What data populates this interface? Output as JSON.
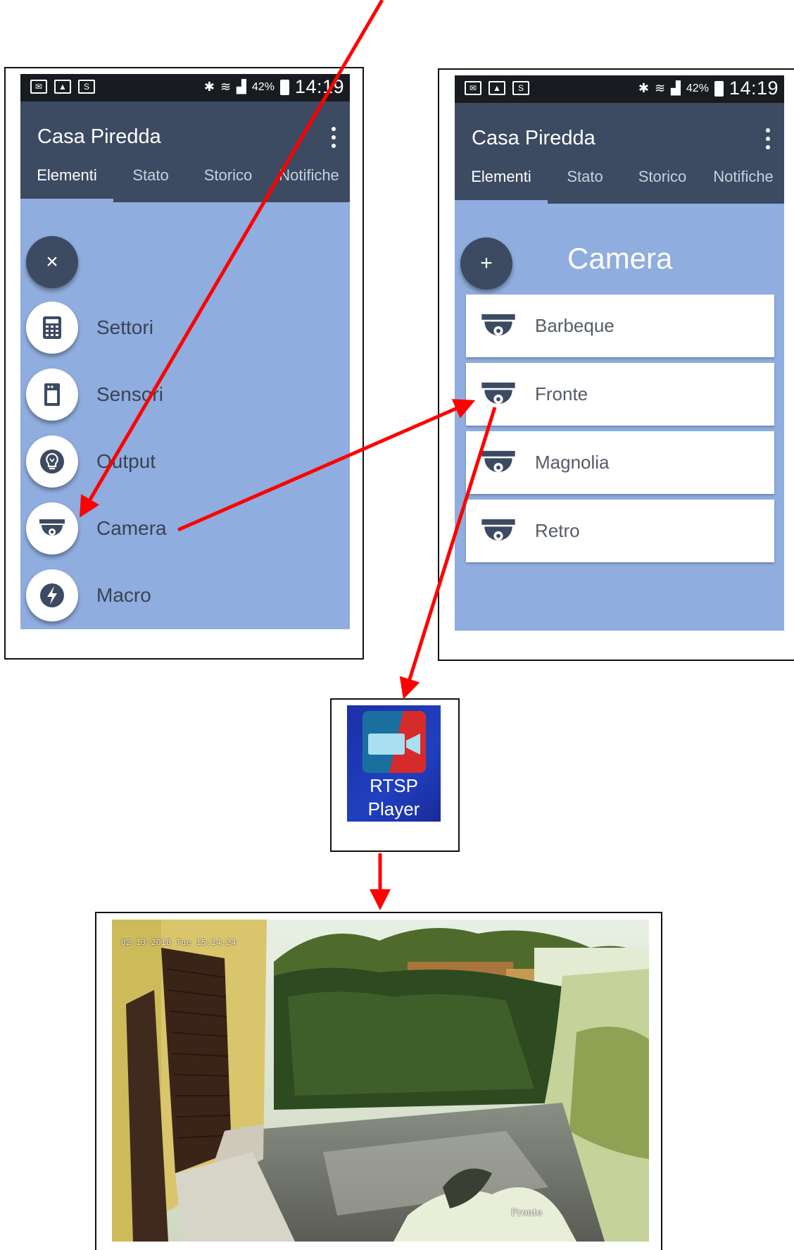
{
  "status_bar": {
    "battery": "42%",
    "time_left": "14:19",
    "time_right": "14:19"
  },
  "app": {
    "title": "Casa Piredda"
  },
  "tabs": [
    {
      "label": "Elementi",
      "active": true
    },
    {
      "label": "Stato"
    },
    {
      "label": "Storico"
    },
    {
      "label": "Notifiche"
    }
  ],
  "left_screen": {
    "fab_icon": "close-icon",
    "fab_label": "×",
    "menu": [
      {
        "label": "Settori",
        "icon": "keypad-icon"
      },
      {
        "label": "Sensori",
        "icon": "door-sensor-icon"
      },
      {
        "label": "Output",
        "icon": "bulb-icon"
      },
      {
        "label": "Camera",
        "icon": "dome-camera-icon"
      },
      {
        "label": "Macro",
        "icon": "lightning-icon"
      }
    ]
  },
  "right_screen": {
    "fab_icon": "add-icon",
    "fab_label": "+",
    "section_title": "Camera",
    "cameras": [
      {
        "label": "Barbeque"
      },
      {
        "label": "Fronte"
      },
      {
        "label": "Magnolia"
      },
      {
        "label": "Retro"
      }
    ]
  },
  "rtsp_app": {
    "line1": "RTSP",
    "line2": "Player"
  },
  "camera_feed": {
    "timestamp": "02-13-2018 Tue 15:14:24",
    "camera_name": "Fronte"
  },
  "colors": {
    "arrow": "#ff0000",
    "appbar": "#3c4a62",
    "content_bg": "#8fadde"
  }
}
